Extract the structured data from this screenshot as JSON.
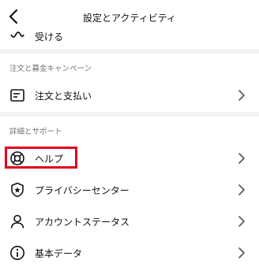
{
  "header": {
    "title": "設定とアクティビティ"
  },
  "partial_item": {
    "label": "受ける"
  },
  "sections": [
    {
      "title": "注文と募金キャンペーン",
      "items": [
        {
          "label": "注文と支払い",
          "icon": "receipt-icon"
        }
      ]
    },
    {
      "title": "詳細とサポート",
      "items": [
        {
          "label": "ヘルプ",
          "icon": "lifebuoy-icon"
        },
        {
          "label": "プライバシーセンター",
          "icon": "shield-star-icon"
        },
        {
          "label": "アカウントステータス",
          "icon": "person-icon"
        },
        {
          "label": "基本データ",
          "icon": "info-icon"
        }
      ]
    }
  ],
  "highlight_color": "#e0001b"
}
